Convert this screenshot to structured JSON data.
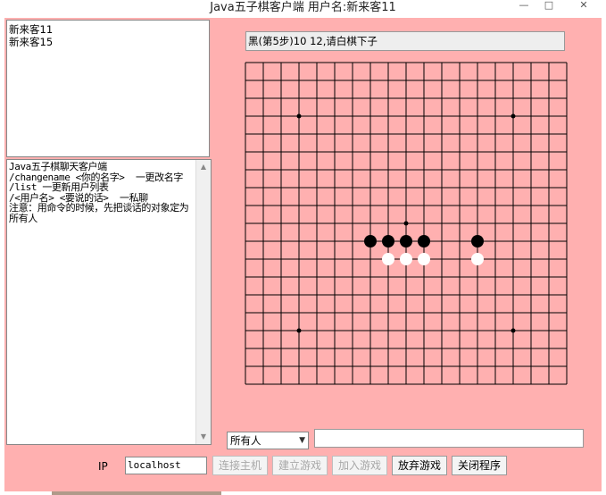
{
  "window": {
    "title": "Java五子棋客户端  用户名:新来客11",
    "min_glyph": "—",
    "max_glyph": "□",
    "close_glyph": "✕"
  },
  "users": [
    "新来客11",
    "新来客15"
  ],
  "chat": {
    "text": "Java五子棋聊天客户端\n/changename <你的名字>  一更改名字\n/list 一更新用户列表\n/<用户名> <要说的话>  一私聊\n注意：用命令的时候，先把谈话的对象定为所有人"
  },
  "status": "黑(第5步)10 12,请白棋下子",
  "board": {
    "size": 19,
    "star_points": [
      [
        3,
        3
      ],
      [
        15,
        3
      ],
      [
        9,
        9
      ],
      [
        3,
        15
      ],
      [
        15,
        15
      ]
    ],
    "black_stones": [
      [
        7,
        10
      ],
      [
        8,
        10
      ],
      [
        9,
        10
      ],
      [
        10,
        10
      ],
      [
        13,
        10
      ]
    ],
    "white_stones": [
      [
        8,
        11
      ],
      [
        9,
        11
      ],
      [
        10,
        11
      ],
      [
        13,
        11
      ]
    ],
    "colors": {
      "grid": "#000000",
      "black": "#000000",
      "white": "#ffffff",
      "background": "#ffb0b0"
    }
  },
  "target_select": {
    "value": "所有人",
    "arrow": "▼"
  },
  "message_input": {
    "value": ""
  },
  "ip": {
    "label": "IP",
    "value": "localhost"
  },
  "buttons": {
    "connect": "连接主机",
    "create": "建立游戏",
    "join": "加入游戏",
    "giveup": "放弃游戏",
    "exit": "关闭程序"
  },
  "scroll": {
    "up": "▲",
    "down": "▼"
  }
}
